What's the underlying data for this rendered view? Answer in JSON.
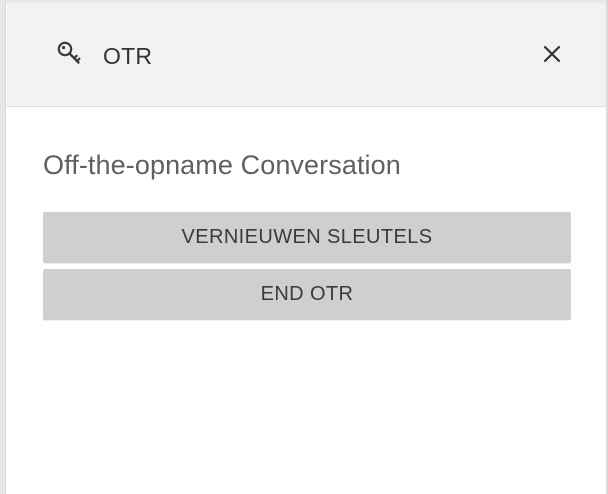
{
  "panel": {
    "title": "OTR",
    "header_icon": "key-icon",
    "close_icon": "close-icon"
  },
  "content": {
    "subtitle": "Off-the-opname Conversation",
    "buttons": {
      "renew_keys": "VERNIEUWEN SLEUTELS",
      "end_otr": "END OTR"
    }
  },
  "colors": {
    "header_background": "#f1f2f3",
    "button_background": "#cfcfcf",
    "text": "#333333"
  }
}
